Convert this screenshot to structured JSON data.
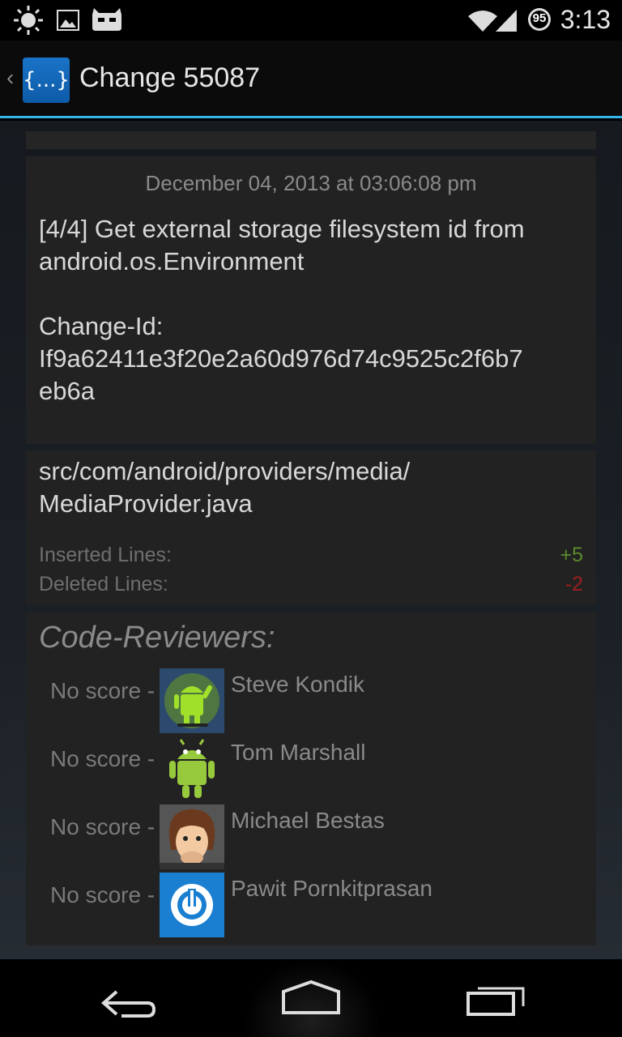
{
  "status_bar": {
    "time": "3:13",
    "badge": "95",
    "icons": [
      "brightness-icon",
      "picture-icon",
      "cyanogenmod-icon",
      "wifi-icon",
      "signal-icon",
      "badge-icon"
    ]
  },
  "action_bar": {
    "title": "Change 55087",
    "logo_text": "{...}"
  },
  "commit": {
    "date": "December 04, 2013 at 03:06:08 pm",
    "subject_line1": "[4/4] Get external storage filesystem id from",
    "subject_line2": "android.os.Environment",
    "change_id_label": "Change-Id:",
    "change_id_line1": "If9a62411e3f20e2a60d976d74c9525c2f6b7",
    "change_id_line2": "eb6a"
  },
  "file": {
    "path_line1": "src/com/android/providers/media/",
    "path_line2": "MediaProvider.java",
    "inserted_label": "Inserted Lines:",
    "inserted_value": "+5",
    "deleted_label": "Deleted Lines:",
    "deleted_value": "-2"
  },
  "reviewers": {
    "header": "Code-Reviewers:",
    "items": [
      {
        "score": "No score -",
        "name": "Steve Kondik"
      },
      {
        "score": "No score -",
        "name": "Tom Marshall"
      },
      {
        "score": "No score -",
        "name": "Michael Bestas"
      },
      {
        "score": "No score -",
        "name": "Pawit Pornkitprasan"
      }
    ]
  },
  "colors": {
    "accent": "#33b5e5",
    "inserted": "#5c8a2a",
    "deleted": "#9c1f1f"
  }
}
